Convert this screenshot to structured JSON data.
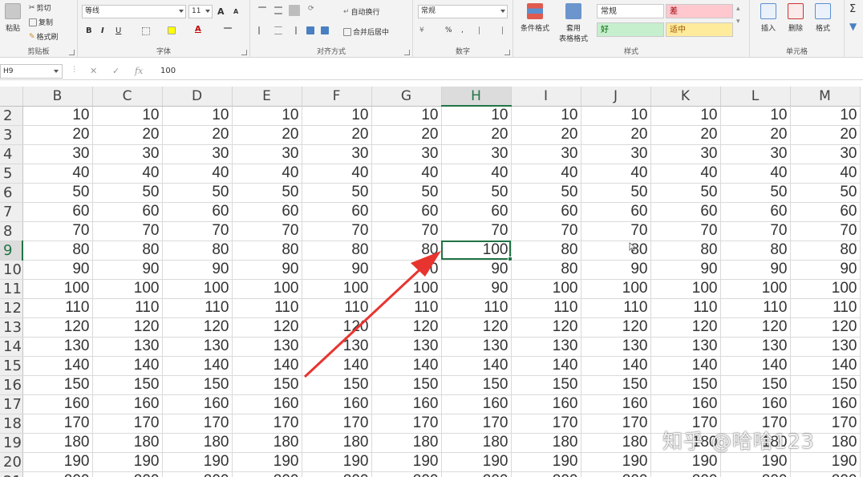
{
  "clipboard": {
    "paste_label": "粘贴",
    "cut_label": "剪切",
    "copy_label": "复制",
    "format_painter_label": "格式刷",
    "group_label": "剪贴板"
  },
  "font": {
    "name": "等线",
    "size": "11",
    "grow_label": "A",
    "shrink_label": "A",
    "bold_label": "B",
    "italic_label": "I",
    "underline_label": "U",
    "color_label": "A",
    "group_label": "字体"
  },
  "alignment": {
    "wrap_label": "自动换行",
    "merge_label": "合并后居中",
    "group_label": "对齐方式"
  },
  "number": {
    "format": "常规",
    "percent_label": "%",
    "comma_label": ",",
    "group_label": "数字"
  },
  "styles": {
    "conditional_label": "条件格式",
    "table_label_1": "套用",
    "table_label_2": "表格格式",
    "normal_label": "常规",
    "bad_label": "差",
    "good_label": "好",
    "neutral_label": "适中",
    "group_label": "样式"
  },
  "cells": {
    "insert_label": "插入",
    "delete_label": "删除",
    "format_label": "格式",
    "group_label": "单元格"
  },
  "formula_bar": {
    "name_box": "H9",
    "cancel_symbol": "✕",
    "enter_symbol": "✓",
    "fx_symbol": "fx",
    "content": "100"
  },
  "columns": [
    "B",
    "C",
    "D",
    "E",
    "F",
    "G",
    "H",
    "I",
    "J",
    "K",
    "L",
    "M"
  ],
  "selected_column": "H",
  "selected_row": "9",
  "rows": [
    {
      "num": "2",
      "cells": [
        "10",
        "10",
        "10",
        "10",
        "10",
        "10",
        "10",
        "10",
        "10",
        "10",
        "10",
        "10"
      ]
    },
    {
      "num": "3",
      "cells": [
        "20",
        "20",
        "20",
        "20",
        "20",
        "20",
        "20",
        "20",
        "20",
        "20",
        "20",
        "20"
      ]
    },
    {
      "num": "4",
      "cells": [
        "30",
        "30",
        "30",
        "30",
        "30",
        "30",
        "30",
        "30",
        "30",
        "30",
        "30",
        "30"
      ]
    },
    {
      "num": "5",
      "cells": [
        "40",
        "40",
        "40",
        "40",
        "40",
        "40",
        "40",
        "40",
        "40",
        "40",
        "40",
        "40"
      ]
    },
    {
      "num": "6",
      "cells": [
        "50",
        "50",
        "50",
        "50",
        "50",
        "50",
        "50",
        "50",
        "50",
        "50",
        "50",
        "50"
      ]
    },
    {
      "num": "7",
      "cells": [
        "60",
        "60",
        "60",
        "60",
        "60",
        "60",
        "60",
        "60",
        "60",
        "60",
        "60",
        "60"
      ]
    },
    {
      "num": "8",
      "cells": [
        "70",
        "70",
        "70",
        "70",
        "70",
        "70",
        "70",
        "70",
        "70",
        "70",
        "70",
        "70"
      ]
    },
    {
      "num": "9",
      "cells": [
        "80",
        "80",
        "80",
        "80",
        "80",
        "80",
        "100",
        "80",
        "80",
        "80",
        "80",
        "80"
      ]
    },
    {
      "num": "10",
      "cells": [
        "90",
        "90",
        "90",
        "90",
        "90",
        "90",
        "90",
        "80",
        "90",
        "90",
        "90",
        "90"
      ]
    },
    {
      "num": "11",
      "cells": [
        "100",
        "100",
        "100",
        "100",
        "100",
        "100",
        "90",
        "100",
        "100",
        "100",
        "100",
        "100"
      ]
    },
    {
      "num": "12",
      "cells": [
        "110",
        "110",
        "110",
        "110",
        "110",
        "110",
        "110",
        "110",
        "110",
        "110",
        "110",
        "110"
      ]
    },
    {
      "num": "13",
      "cells": [
        "120",
        "120",
        "120",
        "120",
        "120",
        "120",
        "120",
        "120",
        "120",
        "120",
        "120",
        "120"
      ]
    },
    {
      "num": "14",
      "cells": [
        "130",
        "130",
        "130",
        "130",
        "130",
        "130",
        "130",
        "130",
        "130",
        "130",
        "130",
        "130"
      ]
    },
    {
      "num": "15",
      "cells": [
        "140",
        "140",
        "140",
        "140",
        "140",
        "140",
        "140",
        "140",
        "140",
        "140",
        "140",
        "140"
      ]
    },
    {
      "num": "16",
      "cells": [
        "150",
        "150",
        "150",
        "150",
        "150",
        "150",
        "150",
        "150",
        "150",
        "150",
        "150",
        "150"
      ]
    },
    {
      "num": "17",
      "cells": [
        "160",
        "160",
        "160",
        "160",
        "160",
        "160",
        "160",
        "160",
        "160",
        "160",
        "160",
        "160"
      ]
    },
    {
      "num": "18",
      "cells": [
        "170",
        "170",
        "170",
        "170",
        "170",
        "170",
        "170",
        "170",
        "170",
        "170",
        "170",
        "170"
      ]
    },
    {
      "num": "19",
      "cells": [
        "180",
        "180",
        "180",
        "180",
        "180",
        "180",
        "180",
        "180",
        "180",
        "180",
        "180",
        "180"
      ]
    },
    {
      "num": "20",
      "cells": [
        "190",
        "190",
        "190",
        "190",
        "190",
        "190",
        "190",
        "190",
        "190",
        "190",
        "190",
        "190"
      ]
    },
    {
      "num": "21",
      "cells": [
        "200",
        "200",
        "200",
        "200",
        "200",
        "200",
        "200",
        "200",
        "200",
        "200",
        "200",
        "200"
      ]
    }
  ],
  "watermark": "知乎 @哈哈123",
  "colors": {
    "excel_green": "#217346",
    "arrow_red": "#e8342f",
    "bad_bg": "#ffc7ce",
    "good_bg": "#c6efce",
    "neutral_bg": "#ffeb9c"
  }
}
